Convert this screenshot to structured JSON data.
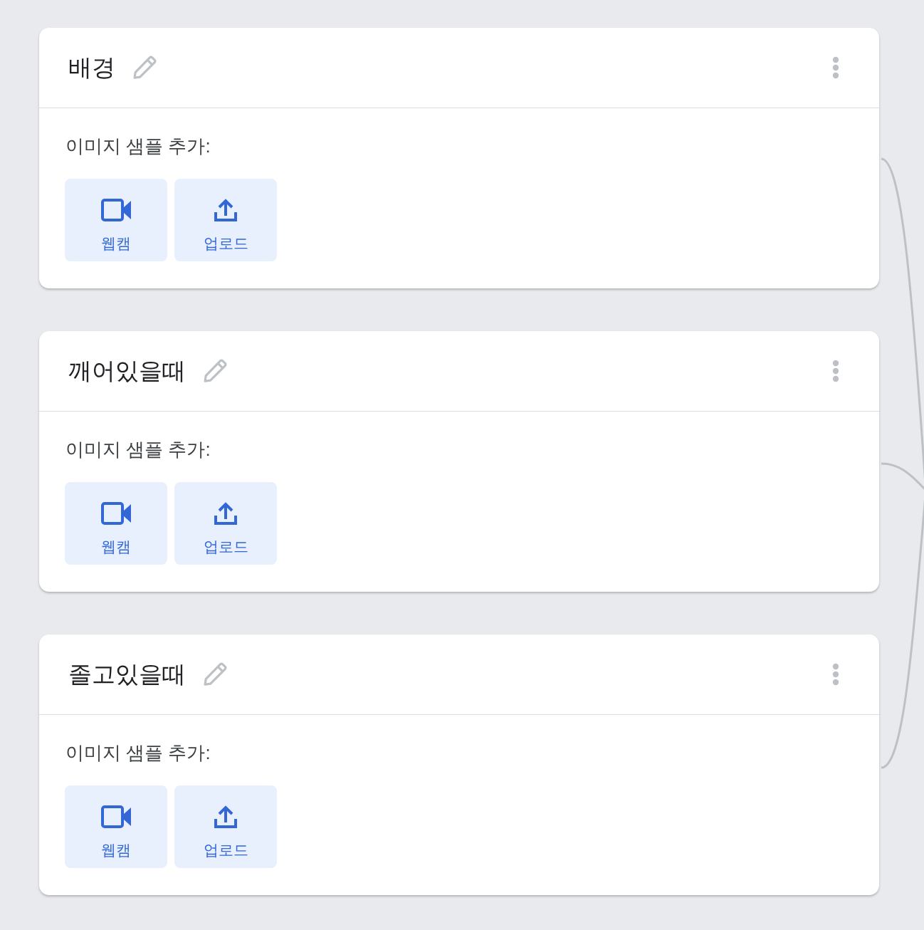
{
  "classes": [
    {
      "name": "배경",
      "sample_prompt": "이미지 샘플 추가:",
      "buttons": [
        {
          "kind": "webcam",
          "label": "웹캠"
        },
        {
          "kind": "upload",
          "label": "업로드"
        }
      ]
    },
    {
      "name": "깨어있을때",
      "sample_prompt": "이미지 샘플 추가:",
      "buttons": [
        {
          "kind": "webcam",
          "label": "웹캠"
        },
        {
          "kind": "upload",
          "label": "업로드"
        }
      ]
    },
    {
      "name": "졸고있을때",
      "sample_prompt": "이미지 샘플 추가:",
      "buttons": [
        {
          "kind": "webcam",
          "label": "웹캠"
        },
        {
          "kind": "upload",
          "label": "업로드"
        }
      ]
    }
  ]
}
